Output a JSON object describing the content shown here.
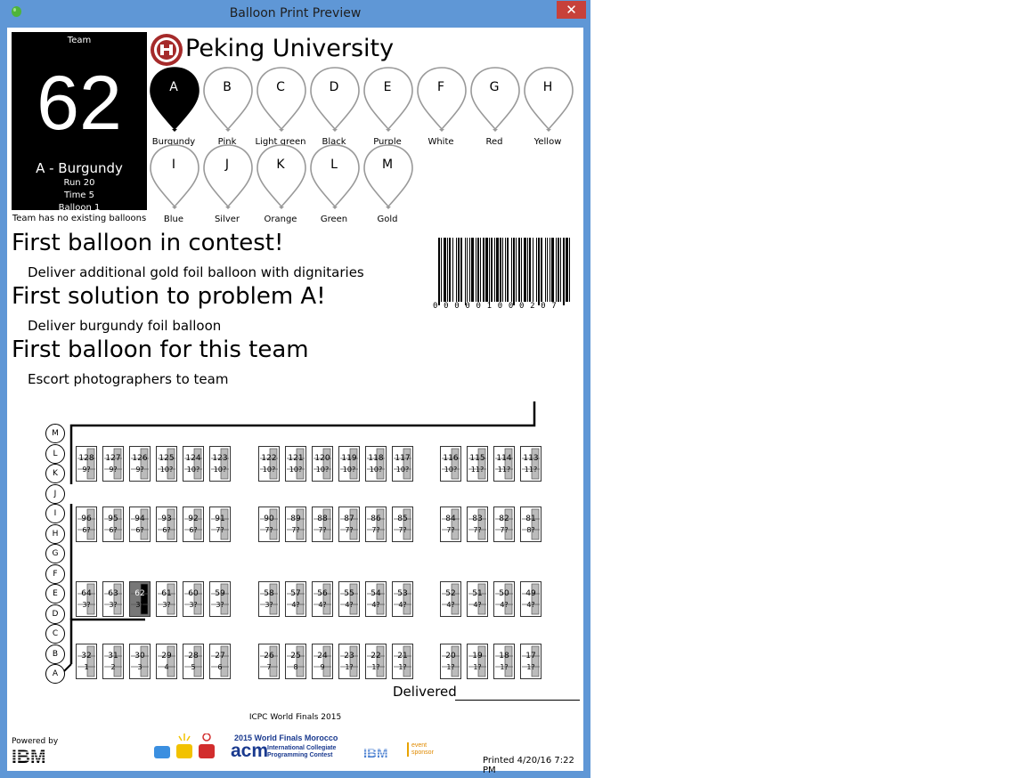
{
  "window": {
    "title": "Balloon Print Preview",
    "close_label": "✕"
  },
  "team": {
    "label": "Team",
    "number": "62",
    "color_line": "A - Burgundy",
    "run": "Run 20",
    "time": "Time 5",
    "balloon": "Balloon 1",
    "existing": "Team has no existing balloons"
  },
  "university": "Peking University",
  "balloons": [
    {
      "letter": "A",
      "color": "Burgundy",
      "solved": true
    },
    {
      "letter": "B",
      "color": "Pink",
      "solved": false
    },
    {
      "letter": "C",
      "color": "Light green",
      "solved": false
    },
    {
      "letter": "D",
      "color": "Black",
      "solved": false
    },
    {
      "letter": "E",
      "color": "Purple",
      "solved": false
    },
    {
      "letter": "F",
      "color": "White",
      "solved": false
    },
    {
      "letter": "G",
      "color": "Red",
      "solved": false
    },
    {
      "letter": "H",
      "color": "Yellow",
      "solved": false
    },
    {
      "letter": "I",
      "color": "Blue",
      "solved": false
    },
    {
      "letter": "J",
      "color": "Silver",
      "solved": false
    },
    {
      "letter": "K",
      "color": "Orange",
      "solved": false
    },
    {
      "letter": "L",
      "color": "Green",
      "solved": false
    },
    {
      "letter": "M",
      "color": "Gold",
      "solved": false
    }
  ],
  "messages": [
    {
      "heading": "First balloon in contest!",
      "detail": "Deliver additional gold foil balloon with dignitaries"
    },
    {
      "heading": "First solution to problem A!",
      "detail": "Deliver burgundy foil balloon"
    },
    {
      "heading": "First balloon for this team",
      "detail": "Escort photographers to team"
    }
  ],
  "barcode_text": "000001000207",
  "map": {
    "aisles": [
      "M",
      "L",
      "K",
      "J",
      "I",
      "H",
      "G",
      "F",
      "E",
      "D",
      "C",
      "B",
      "A"
    ],
    "rows": [
      {
        "seats": [
          [
            "128",
            "9?"
          ],
          [
            "127",
            "9?"
          ],
          [
            "126",
            "9?"
          ],
          [
            "125",
            "10?"
          ],
          [
            "124",
            "10?"
          ],
          [
            "123",
            "10?"
          ],
          [
            "122",
            "10?"
          ],
          [
            "121",
            "10?"
          ],
          [
            "120",
            "10?"
          ],
          [
            "119",
            "10?"
          ],
          [
            "118",
            "10?"
          ],
          [
            "117",
            "10?"
          ],
          [
            "116",
            "10?"
          ],
          [
            "115",
            "11?"
          ],
          [
            "114",
            "11?"
          ],
          [
            "113",
            "11?"
          ]
        ]
      },
      {
        "seats": [
          [
            "96",
            "6?"
          ],
          [
            "95",
            "6?"
          ],
          [
            "94",
            "6?"
          ],
          [
            "93",
            "6?"
          ],
          [
            "92",
            "6?"
          ],
          [
            "91",
            "7?"
          ],
          [
            "90",
            "7?"
          ],
          [
            "89",
            "7?"
          ],
          [
            "88",
            "7?"
          ],
          [
            "87",
            "7?"
          ],
          [
            "86",
            "7?"
          ],
          [
            "85",
            "7?"
          ],
          [
            "84",
            "7?"
          ],
          [
            "83",
            "7?"
          ],
          [
            "82",
            "7?"
          ],
          [
            "81",
            "8?"
          ]
        ]
      },
      {
        "seats": [
          [
            "64",
            "3?"
          ],
          [
            "63",
            "3?"
          ],
          [
            "62",
            "3?"
          ],
          [
            "61",
            "3?"
          ],
          [
            "60",
            "3?"
          ],
          [
            "59",
            "3?"
          ],
          [
            "58",
            "3?"
          ],
          [
            "57",
            "4?"
          ],
          [
            "56",
            "4?"
          ],
          [
            "55",
            "4?"
          ],
          [
            "54",
            "4?"
          ],
          [
            "53",
            "4?"
          ],
          [
            "52",
            "4?"
          ],
          [
            "51",
            "4?"
          ],
          [
            "50",
            "4?"
          ],
          [
            "49",
            "4?"
          ]
        ]
      },
      {
        "seats": [
          [
            "32",
            "1"
          ],
          [
            "31",
            "2"
          ],
          [
            "30",
            "3"
          ],
          [
            "29",
            "4"
          ],
          [
            "28",
            "5"
          ],
          [
            "27",
            "6"
          ],
          [
            "26",
            "7"
          ],
          [
            "25",
            "8"
          ],
          [
            "24",
            "9"
          ],
          [
            "23",
            "1?"
          ],
          [
            "22",
            "1?"
          ],
          [
            "21",
            "1?"
          ],
          [
            "20",
            "1?"
          ],
          [
            "19",
            "1?"
          ],
          [
            "18",
            "1?"
          ],
          [
            "17",
            "1?"
          ]
        ]
      }
    ],
    "highlight_team": "62"
  },
  "delivered_label": "Delivered",
  "footer": {
    "event": "ICPC World Finals 2015",
    "powered_by": "Powered by",
    "ibm_logo": "IBM",
    "wf_title": "2015 World Finals Morocco",
    "acm": "acm",
    "acm_sub1": "International Collegiate",
    "acm_sub2": "Programming Contest",
    "event_sponsor": "event sponsor",
    "printed": "Printed 4/20/16 7:22 PM"
  }
}
